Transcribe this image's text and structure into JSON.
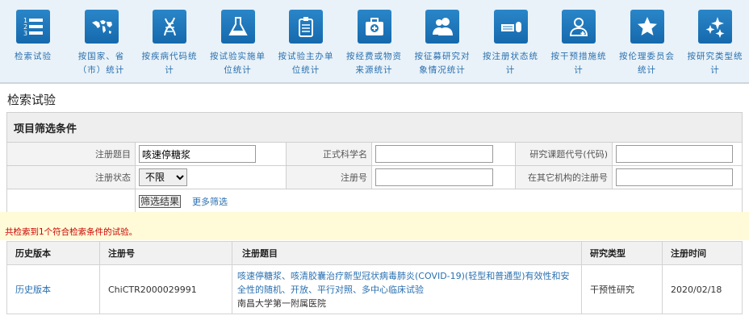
{
  "nav": [
    {
      "label": "检索试验",
      "icon": "numbered-list-icon"
    },
    {
      "label": "按国家、省（市）统计",
      "icon": "world-map-icon"
    },
    {
      "label": "按疾病代码统计",
      "icon": "dna-icon"
    },
    {
      "label": "按试验实施单位统计",
      "icon": "flask-icon"
    },
    {
      "label": "按试验主办单位统计",
      "icon": "clipboard-icon"
    },
    {
      "label": "按经费或物资来源统计",
      "icon": "medical-kit-icon"
    },
    {
      "label": "按征募研究对象情况统计",
      "icon": "people-icon"
    },
    {
      "label": "按注册状态统计",
      "icon": "keyboard-mouse-icon"
    },
    {
      "label": "按干预措施统计",
      "icon": "doctor-icon"
    },
    {
      "label": "按伦理委员会统计",
      "icon": "star-icon"
    },
    {
      "label": "按研究类型统计",
      "icon": "sparkles-icon"
    }
  ],
  "page_title": "检索试验",
  "filter": {
    "header": "项目筛选条件",
    "reg_title_label": "注册题目",
    "reg_title_value": "咳速停糖浆",
    "sci_name_label": "正式科学名",
    "sci_name_value": "",
    "code_label": "研究课题代号(代码)",
    "code_value": "",
    "status_label": "注册状态",
    "status_value": "不限",
    "reg_no_label": "注册号",
    "reg_no_value": "",
    "other_reg_label": "在其它机构的注册号",
    "other_reg_value": "",
    "submit_label": "筛选结果",
    "more_label": "更多筛选"
  },
  "notice": "共检索到1个符合检索条件的试验。",
  "results": {
    "headers": [
      "历史版本",
      "注册号",
      "注册题目",
      "研究类型",
      "注册时间"
    ],
    "rows": [
      {
        "history": "历史版本",
        "reg_no": "ChiCTR2000029991",
        "title": "咳速停糖浆、咳清胶囊治疗新型冠状病毒肺炎(COVID-19)(轻型和普通型)有效性和安全性的随机、开放、平行对照、多中心临床试验",
        "institution": "南昌大学第一附属医院",
        "type": "干预性研究",
        "date": "2020/02/18"
      }
    ]
  }
}
